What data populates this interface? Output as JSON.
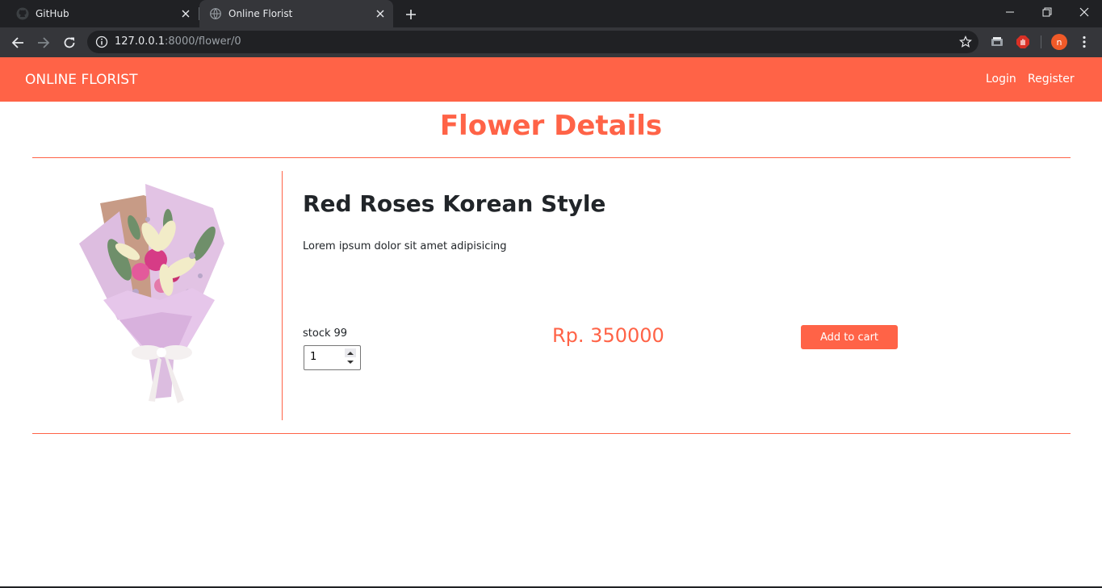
{
  "browser": {
    "tabs": [
      {
        "title": "GitHub",
        "icon": "github-icon",
        "active": false
      },
      {
        "title": "Online Florist",
        "icon": "globe-icon",
        "active": true
      }
    ],
    "url_host": "127.0.0.1",
    "url_path": ":8000/flower/0",
    "profile_initial": "n"
  },
  "site": {
    "brand": "ONLINE FLORIST",
    "nav": {
      "login": "Login",
      "register": "Register"
    },
    "accent_color": "#ff6347"
  },
  "page": {
    "title": "Flower Details",
    "product": {
      "name": "Red Roses Korean Style",
      "description": "Lorem ipsum dolor sit amet adipisicing",
      "stock_label": "stock",
      "stock_value": "99",
      "quantity": "1",
      "price": "Rp. 350000",
      "add_to_cart": "Add to cart"
    }
  }
}
